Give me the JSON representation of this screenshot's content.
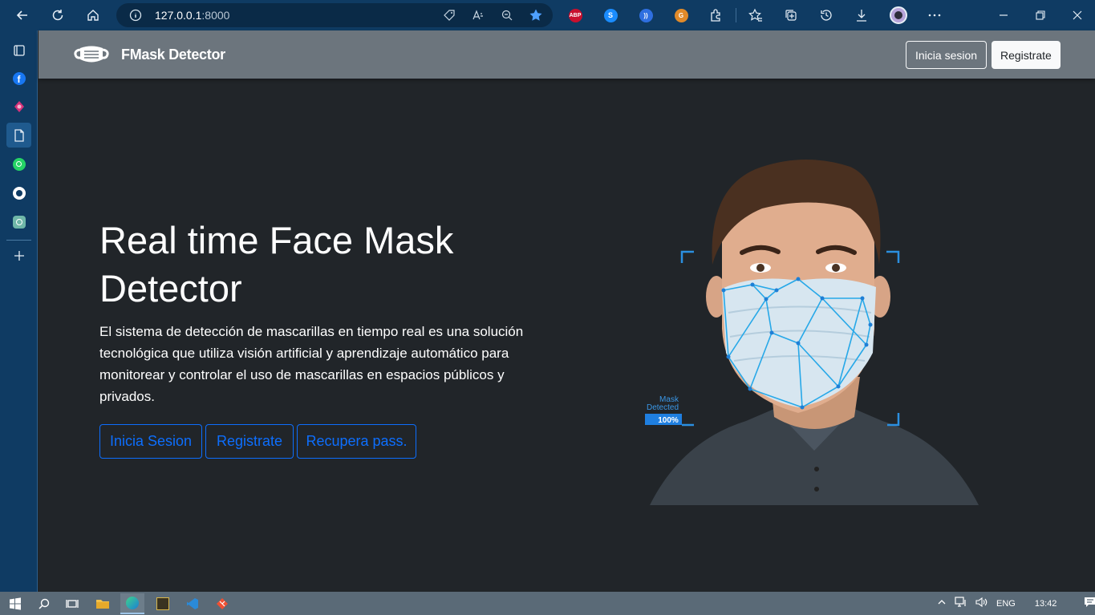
{
  "browser": {
    "url_host": "127.0.0.1",
    "url_port": ":8000",
    "extensions": [
      "ABP",
      "S",
      "))",
      "G"
    ]
  },
  "navbar": {
    "brand": "FMask Detector",
    "login_label": "Inicia sesion",
    "register_label": "Registrate"
  },
  "hero": {
    "title": "Real time Face Mask Detector",
    "description": "El sistema de detección de mascarillas en tiempo real es una solución tecnológica que utiliza visión artificial y aprendizaje automático para monitorear y controlar el uso de mascarillas en espacios públicos y privados.",
    "buttons": {
      "login": "Inicia Sesion",
      "register": "Registrate",
      "recover": "Recupera pass."
    }
  },
  "illustration": {
    "label_line1": "Mask",
    "label_line2": "Detected",
    "confidence": "100%"
  },
  "taskbar": {
    "language": "ENG",
    "time": "13:42"
  },
  "colors": {
    "accent": "#0d6efd",
    "navbar": "#6c757d",
    "page_bg": "#212529",
    "browser_chrome": "#0f3b63"
  }
}
